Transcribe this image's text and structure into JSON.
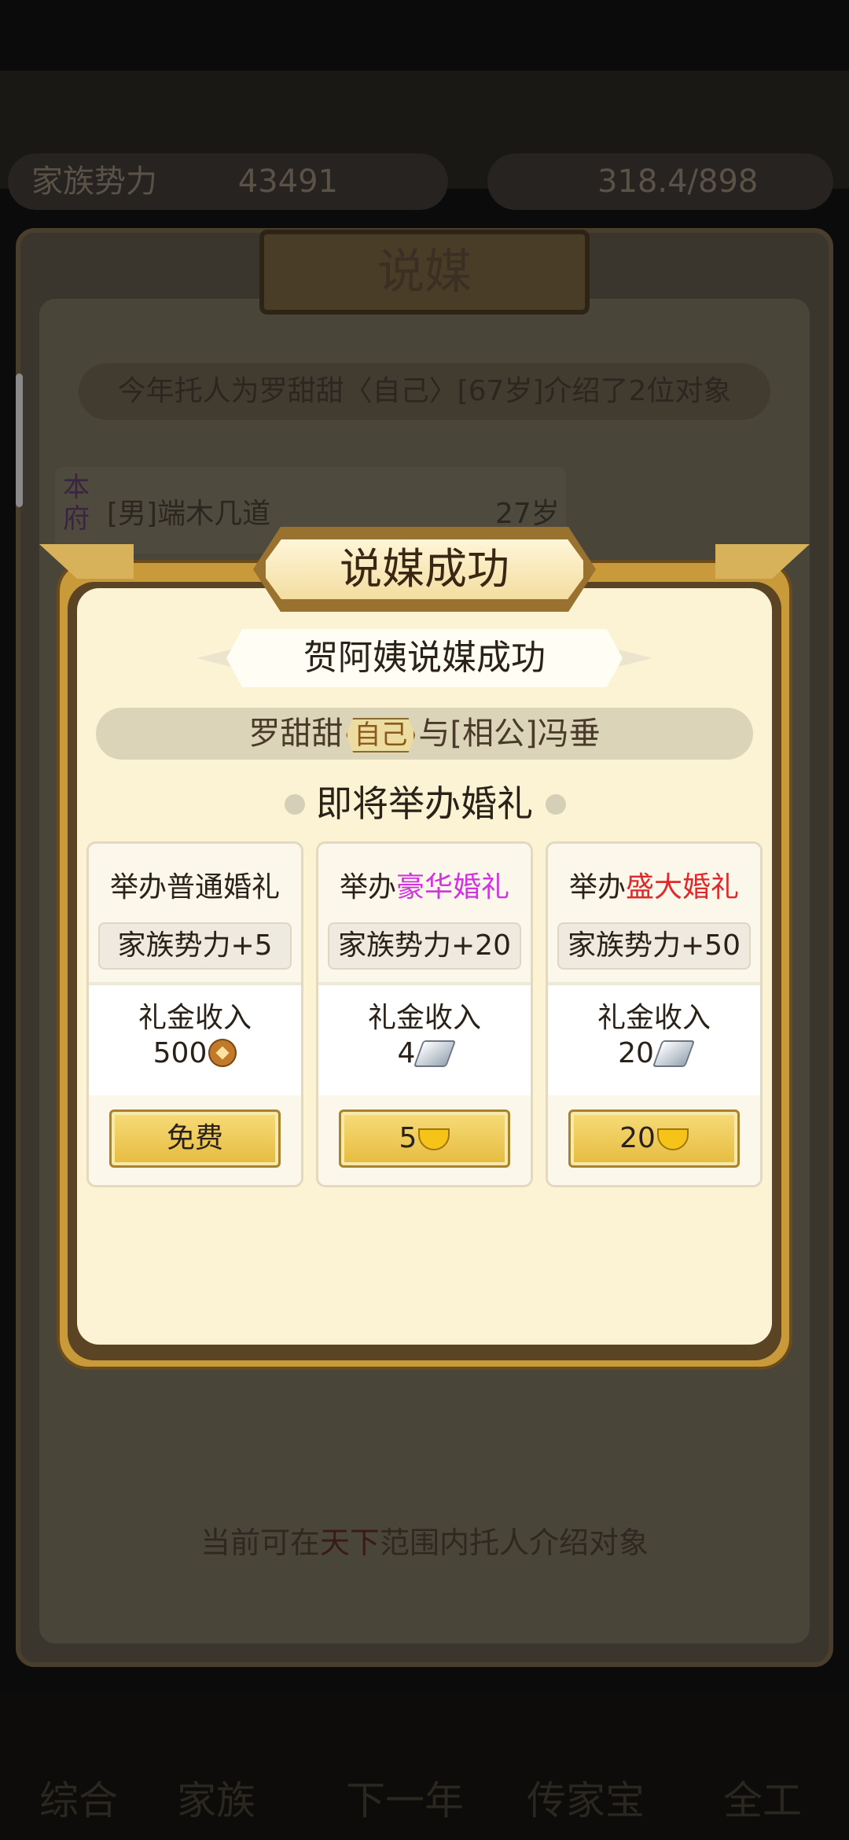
{
  "background": {
    "resource_left": "家族势力",
    "resource_left_value": "43491",
    "resource_right": "318.4/898",
    "panel_title": "说媒",
    "intro_line": "今年托人为罗甜甜〈自己〉[67岁]介绍了2位对象",
    "candidate": {
      "badge": "本府",
      "name": "[男]端木几道",
      "age": "27岁"
    },
    "bottom_prefix": "当前可在",
    "bottom_highlight": "天下",
    "bottom_suffix": "范围内托人介绍对象",
    "nav": [
      "综合",
      "家族",
      "下一年",
      "传家宝",
      "全工"
    ]
  },
  "popup": {
    "title": "说媒成功",
    "banner": "贺阿姨说媒成功",
    "couple_left": "罗甜甜",
    "couple_tag": "自己",
    "couple_right": "与[相公]冯垂",
    "section_title": "即将举办婚礼",
    "cards": [
      {
        "title_prefix": "举办普通婚礼",
        "title_highlight": "",
        "power": "家族势力+5",
        "income_label": "礼金收入",
        "income_value": "500",
        "income_icon": "copper-coin-icon",
        "button_label": "免费"
      },
      {
        "title_prefix": "举办",
        "title_highlight": "豪华婚礼",
        "power": "家族势力+20",
        "income_label": "礼金收入",
        "income_value": "4",
        "income_icon": "silver-ingot-icon",
        "button_label": "5"
      },
      {
        "title_prefix": "举办",
        "title_highlight": "盛大婚礼",
        "power": "家族势力+50",
        "income_label": "礼金收入",
        "income_value": "20",
        "income_icon": "silver-ingot-icon",
        "button_label": "20"
      }
    ]
  },
  "colors": {
    "purple_highlight": "#d233e0",
    "red_highlight": "#e02a2a",
    "gold_button": "#e6bb3e"
  }
}
